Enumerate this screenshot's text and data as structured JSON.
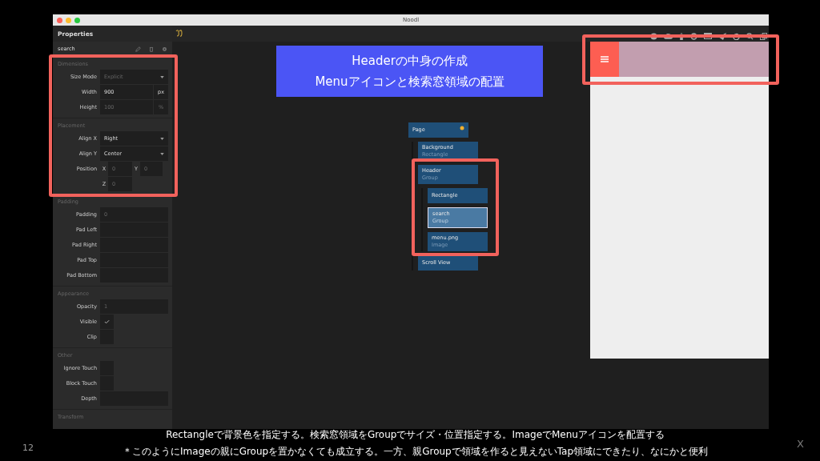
{
  "window": {
    "title": "Noodl"
  },
  "properties": {
    "title": "Properties",
    "node_name": "search",
    "sections": [
      {
        "title": "Dimensions",
        "rows": [
          {
            "kind": "dropdown",
            "label": "Size Mode",
            "placeholder": "Explicit"
          },
          {
            "kind": "number",
            "label": "Width",
            "value": "900",
            "unit": "px"
          },
          {
            "kind": "number",
            "label": "Height",
            "placeholder": "100",
            "unit": "%"
          }
        ]
      },
      {
        "title": "Placement",
        "rows": [
          {
            "kind": "dropdown",
            "label": "Align X",
            "value": "Right"
          },
          {
            "kind": "dropdown",
            "label": "Align Y",
            "value": "Center"
          },
          {
            "kind": "position",
            "label": "Position",
            "axes": [
              {
                "label": "X",
                "placeholder": "0"
              },
              {
                "label": "Y",
                "placeholder": "0"
              },
              {
                "label": "Z",
                "placeholder": "0"
              }
            ]
          }
        ]
      },
      {
        "title": "Padding",
        "rows": [
          {
            "kind": "number",
            "label": "Padding",
            "placeholder": "0"
          },
          {
            "kind": "number",
            "label": "Pad Left"
          },
          {
            "kind": "number",
            "label": "Pad Right"
          },
          {
            "kind": "number",
            "label": "Pad Top"
          },
          {
            "kind": "number",
            "label": "Pad Bottom"
          }
        ]
      },
      {
        "title": "Appearance",
        "rows": [
          {
            "kind": "number",
            "label": "Opacity",
            "placeholder": "1"
          },
          {
            "kind": "checkbox",
            "label": "Visible",
            "checked": true
          },
          {
            "kind": "checkbox",
            "label": "Clip",
            "checked": false
          }
        ]
      },
      {
        "title": "Other",
        "rows": [
          {
            "kind": "checkbox",
            "label": "Ignore Touch",
            "checked": false
          },
          {
            "kind": "checkbox",
            "label": "Block Touch",
            "checked": false
          },
          {
            "kind": "number",
            "label": "Depth"
          }
        ]
      },
      {
        "title": "Transform"
      }
    ]
  },
  "tree": [
    {
      "title": "Page",
      "starred": true,
      "selected": false,
      "children": [
        {
          "title": "Background",
          "type": "Rectangle",
          "starred": false,
          "selected": false
        },
        {
          "title": "Header",
          "type": "Group",
          "starred": false,
          "selected": false,
          "children": [
            {
              "title": "Rectangle",
              "starred": false,
              "selected": false
            },
            {
              "title": "search",
              "type": "Group",
              "starred": false,
              "selected": true
            },
            {
              "title": "menu.png",
              "type": "Image",
              "starred": false,
              "selected": false
            }
          ]
        },
        {
          "title": "Scroll View",
          "starred": false,
          "selected": false
        }
      ]
    }
  ],
  "callout": [
    "Headerの中身の作成",
    "Menuアイコンと検索窓領域の配置"
  ],
  "captions": [
    "Rectangleで背景色を指定する。検索窓領域をGroupでサイズ・位置指定する。ImageでMenuアイコンを配置する",
    "＊このようにImageの親にGroupを置かなくても成立する。一方、親Groupで領域を作ると見えないTap領域にできたり、なにかと便利"
  ],
  "slide_number": "12",
  "corner_mark": "X"
}
